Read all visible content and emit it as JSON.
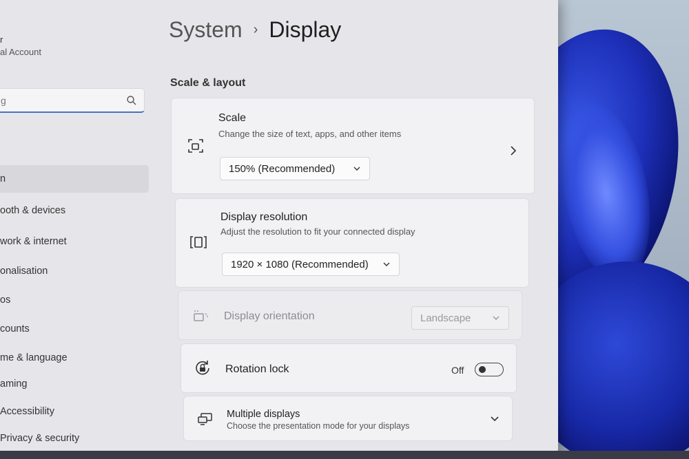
{
  "account": {
    "name": "r",
    "type": "al Account"
  },
  "search": {
    "value": "g"
  },
  "nav": [
    {
      "label": "n",
      "active": true
    },
    {
      "label": "ooth & devices",
      "active": false
    },
    {
      "label": "work & internet",
      "active": false
    },
    {
      "label": "onalisation",
      "active": false
    },
    {
      "label": "os",
      "active": false
    },
    {
      "label": "counts",
      "active": false
    },
    {
      "label": "me & language",
      "active": false
    },
    {
      "label": "aming",
      "active": false
    },
    {
      "label": "Accessibility",
      "active": false
    },
    {
      "label": "Privacy & security",
      "active": false
    }
  ],
  "header": {
    "parent": "System",
    "current": "Display"
  },
  "section": {
    "title": "Scale & layout"
  },
  "scale": {
    "title": "Scale",
    "subtitle": "Change the size of text, apps, and other items",
    "value": "150% (Recommended)",
    "icon": "scale-icon"
  },
  "resolution": {
    "title": "Display resolution",
    "subtitle": "Adjust the resolution to fit your connected display",
    "value": "1920 × 1080 (Recommended)",
    "icon": "resolution-icon"
  },
  "orientation": {
    "title": "Display orientation",
    "value": "Landscape",
    "icon": "orientation-icon",
    "disabled": true
  },
  "rotation": {
    "title": "Rotation lock",
    "state": "Off",
    "icon": "rotation-lock-icon"
  },
  "multiple": {
    "title": "Multiple displays",
    "subtitle": "Choose the presentation mode for your displays",
    "icon": "multiple-displays-icon"
  },
  "colors": {
    "accent": "#4a6fc2",
    "window_bg": "#e6e6ea",
    "card_bg": "#f2f2f5"
  }
}
